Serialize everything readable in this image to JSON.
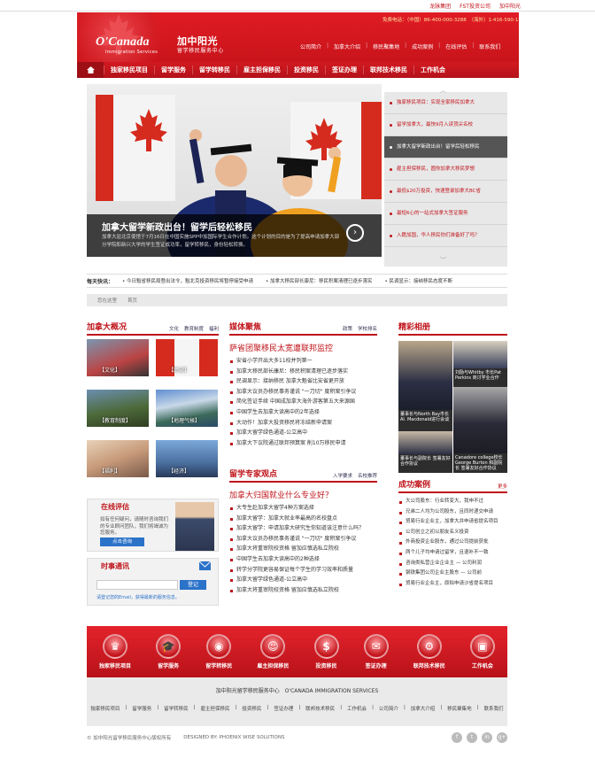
{
  "topbar": {
    "links": [
      "龙脉集团",
      "FST投资公司",
      "加中阳光"
    ]
  },
  "header": {
    "logo_text": "O'Canada",
    "logo_sub": "Immigration Services",
    "brand_cn": "加中阳光",
    "brand_cn_sub": "留学移民服务中心",
    "hotline": "免费电话：（中国）86-400-000-3288　（海外）1-416-590-1576",
    "nav": [
      "公司简介",
      "加拿大介绍",
      "移民聚集地",
      "成功案例",
      "在线评估",
      "联系我们"
    ]
  },
  "mainnav": {
    "items": [
      "独家移民项目",
      "留学服务",
      "留学转移民",
      "雇主担保移民",
      "投资移民",
      "签证办理",
      "联邦技术移民",
      "工作机会"
    ]
  },
  "banner": {
    "title": "加拿大留学新政出台！留学后轻松移民",
    "desc": "加拿大驻北京使馆于7月16日在中国实施SPP中加国际学生合作计划。这个计划的目的是为了提高申请加拿大部分学院和新兴大学的学生签证成功率，留学转移民，身份轻松转换。"
  },
  "side_list": [
    "独家移民项目：实现全家移民加拿大",
    "留学加拿大，最快9月入读顶尖名校",
    "加拿大留学新政出台！留学后轻松移民",
    "雇主担保移民，圆你加拿大移民梦想",
    "最低$20万投资，快速登录加拿大BC省",
    "最短6心的一站式加拿大签证服务",
    "入籍加国，华人移民你们准备好了吗？"
  ],
  "ticker": {
    "label": "每天快讯：",
    "items": [
      "今日魁省移民局登出法令，魁北克投资移民将暂停接受申请",
      "加拿大移民部长康尼：移民积案清理已逐步落实",
      "民调显示：接纳移民态度不断"
    ]
  },
  "location": [
    "您在这里",
    "首页"
  ],
  "canada_panel": {
    "title": "加拿大概况",
    "tabs": [
      "文化",
      "教育制度",
      "福利"
    ],
    "thumbs": [
      "【文化】",
      "【历史】",
      "【教育制度】",
      "【地理气候】",
      "【福利】",
      "【经济】"
    ]
  },
  "media_panel": {
    "title": "媒体聚焦",
    "tabs": [
      "政策",
      "学校排名"
    ],
    "headline": "萨省团聚移民太宽遭联邦监控",
    "items": [
      "安省小学开出大多11校并列第一",
      "加拿大移民部长康尼：移民积案清理已逐步落实",
      "民调显示：接纳移民 加拿大魁省比安省更开放",
      "加拿大议员办移民事务谨说 \"一刀切\" 度积案引争议",
      "简化签证手续 中国成加拿大海外游客第五大来源国",
      "中国学生去加拿大读高中的2年选择",
      "大动作！加拿大投资移民将冻结新申请案",
      "加拿大留学绿色通道-公立高中",
      "加拿大下议院通过联邦预算案 削10万移民申请"
    ]
  },
  "expert_panel": {
    "title": "留学专家观点",
    "tabs": [
      "入学要求",
      "名校推荐"
    ],
    "headline": "加拿大归国就业什么专业好？",
    "items": [
      "大专生赴加拿大留学4种方案选择",
      "加拿大留学：加拿大就业率最高的名校盘点",
      "加拿大留学：申请加拿大研究生你知道该注意什么吗？",
      "加拿大议员办移民事务谨说 \"一刀切\" 度积案引争议",
      "加拿大将重审院校资格 留加应慎选私立院校",
      "中国学生去加拿大读高中的2种选择",
      "转学分学院更容易保证每个学生的学习效率和质量",
      "加拿大留学绿色通道-公立高中",
      "加拿大将重审院校资格 留加应慎选私立院校"
    ]
  },
  "photos_panel": {
    "title": "精彩相册",
    "captions": [
      "刘励与Whitby 市长Pat Perkins 商讨学业合作",
      "董事长与North Bay市长 Al. Macdonald进行会谈",
      "Canadore college校长 George Burton 和副院长 签署友好合作协议",
      "董事长与副院长 签署友好合作协议"
    ]
  },
  "cases_panel": {
    "title": "成功案例",
    "more": "更多",
    "items": [
      "大公司股东：行业转变大，我申不过",
      "兄弟二人均为公司股东，且同时递交申请",
      "贸易行业企业主，加拿大并申请省提名项目",
      "公司创立之初以朋友名义投资",
      "外商投资企业股东，通过公司提前获批",
      "两个儿子均申请过留学，且退补不一致",
      "咨询类私营企业企业主 — 公司利润",
      "钢铁集团公司企业主股东 — 公司前",
      "贸易行业企业主，原拟申请沙省提名项目"
    ]
  },
  "assess_panel": {
    "title": "在线评估",
    "text": "如有任何疑问，请随时咨询我们的专业顾问团队，我们将竭诚为您服务。",
    "button": "点击咨询"
  },
  "newsletter_panel": {
    "title": "时事通讯",
    "login_button": "登记",
    "note": "请登记您的Email，获得最新的服务信息。"
  },
  "footer_nav": [
    "独家移民项目",
    "留学服务",
    "留学转移民",
    "雇主担保移民",
    "投资移民",
    "签证办理",
    "联邦技术移民",
    "工作机会"
  ],
  "footer_icons": [
    "crown-icon",
    "graduation-icon",
    "globe-icon",
    "people-icon",
    "coins-icon",
    "stamp-icon",
    "gear-icon",
    "briefcase-icon"
  ],
  "footer": {
    "company": "加中阳光留学移民服务中心　O'CANADA IMMIGRATION SERVICES",
    "links": [
      "独家移民项目",
      "留学服务",
      "留学转移民",
      "雇主担保移民",
      "投资移民",
      "签证办理",
      "联邦技术移民",
      "工作机会",
      "公司简介",
      "加拿大介绍",
      "移民聚集地",
      "联系我们"
    ],
    "copyright": "© 加中阳光留学移民服务中心版权所有",
    "designer": "DESIGNED BY: PHOENIX WISE SOLUTIONS",
    "social": [
      "f",
      "t",
      "in",
      "g+"
    ]
  },
  "colors": {
    "brand_red": "#c9141b",
    "dark": "#333333"
  }
}
